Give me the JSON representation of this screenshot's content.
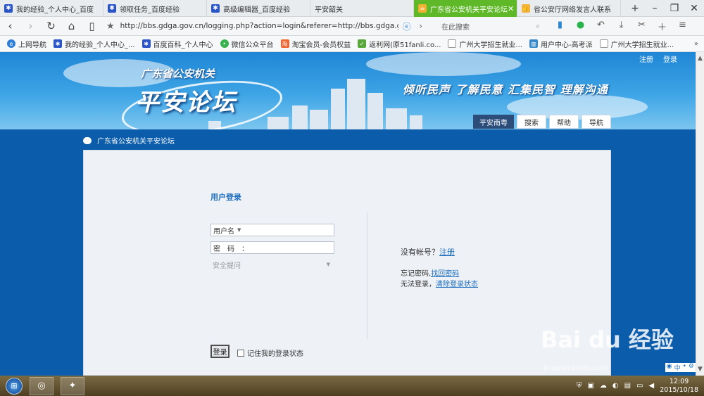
{
  "tabs": [
    {
      "label": "我的经验_个人中心_百度",
      "icon": "paw-icon",
      "active": false
    },
    {
      "label": "领取任务_百度经验",
      "icon": "paw-icon",
      "active": false
    },
    {
      "label": "高级编辑器_百度经验",
      "icon": "paw-icon",
      "active": false
    },
    {
      "label": "平安韶关",
      "icon": "page-icon",
      "active": false
    },
    {
      "label": "广东省公安机关平安论坛",
      "icon": "cup-icon",
      "active": true
    },
    {
      "label": "省公安厅网络发言人联系",
      "icon": "thumb-icon",
      "active": false
    }
  ],
  "window_controls": {
    "new_tab": "+",
    "minimize": "–",
    "restore": "❐",
    "close": "✕"
  },
  "address": {
    "url": "http://bbs.gdga.gov.cn/logging.php?action=login&referer=http://bbs.gdga.gov.cn"
  },
  "search": {
    "placeholder": "在此搜索"
  },
  "bookmarks": [
    {
      "label": "上网导航",
      "icon": "e"
    },
    {
      "label": "我的经验_个人中心_...",
      "icon": "paw"
    },
    {
      "label": "百度百科_个人中心",
      "icon": "paw"
    },
    {
      "label": "微信公众平台",
      "icon": "wx"
    },
    {
      "label": "淘宝会员-会员权益",
      "icon": "tb"
    },
    {
      "label": "返利网(原51fanli.co...",
      "icon": "fl"
    },
    {
      "label": "广州大学招生就业...",
      "icon": "pg"
    },
    {
      "label": "用户中心-高考派",
      "icon": "uc"
    },
    {
      "label": "广州大学招生就业...",
      "icon": "pg"
    }
  ],
  "banner": {
    "subtitle": "广东省公安机关",
    "title": "平安论坛",
    "slogan": "倾听民声 了解民意 汇集民智 理解沟通",
    "top_links": {
      "register": "注册",
      "login": "登录"
    },
    "nav_tabs": [
      "平安南粤",
      "搜索",
      "帮助",
      "导航"
    ]
  },
  "breadcrumb": "广东省公安机关平安论坛",
  "login": {
    "title": "用户登录",
    "username_label": "用户名",
    "password_label": "密　码　：",
    "question_placeholder": "安全提问",
    "submit": "登录",
    "remember": "记住我的登录状态",
    "no_account": "没有帐号？",
    "register_link": "注册",
    "forgot_label": "忘记密码,",
    "forgot_link": "找回密码",
    "cant_login_label": "无法登录，",
    "clear_link": "清除登录状态"
  },
  "watermark": {
    "brand": "Bai du 经验",
    "url": "jingyan.baidu.com"
  },
  "taskbar": {
    "time": "12:09",
    "date": "2015/10/18"
  },
  "colors": {
    "accent": "#1f6fbf",
    "active_tab": "#5fb828",
    "page_bg": "#0b5cab",
    "banner_tab": "#2c4d7a"
  }
}
